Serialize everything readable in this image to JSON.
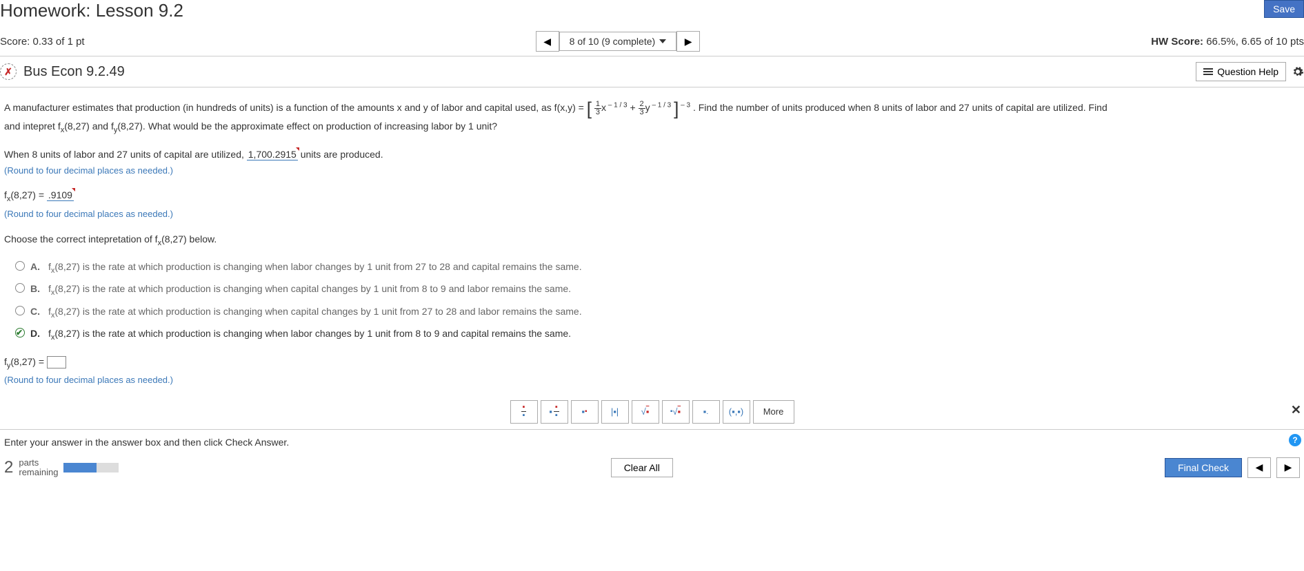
{
  "header": {
    "title": "Homework: Lesson 9.2",
    "save": "Save",
    "score_label": "Score:",
    "score_value": "0.33 of 1 pt",
    "nav_status": "8 of 10 (9 complete)",
    "hw_score_label": "HW Score:",
    "hw_score_value": "66.5%, 6.65 of 10 pts"
  },
  "question": {
    "title": "Bus Econ 9.2.49",
    "help_label": "Question Help"
  },
  "problem": {
    "pre_formula": "A manufacturer estimates that production (in hundreds of units) is a function of the amounts x and y of labor and capital used, as f(x,y) = ",
    "formula_exp_outer": " – 3",
    "post_formula": ". Find the number of units produced when 8 units of labor and 27 units of capital are utilized. Find",
    "line2": "and intepret f",
    "line2b": "(8,27) and f",
    "line2c": "(8,27). What would be the approximate effect on production of increasing labor by 1 unit?"
  },
  "parts": {
    "p1_pre": "When 8 units of labor and 27 units of capital are utilized, ",
    "p1_val": "1,700.2915",
    "p1_post": " units are produced.",
    "hint": "(Round to four decimal places as needed.)",
    "p2_pre": "f",
    "p2_mid": "(8,27) = ",
    "p2_val": ".9109",
    "choose": "Choose the correct intepretation of f",
    "choose_post": "(8,27) below."
  },
  "choices": [
    {
      "letter": "A.",
      "text": "(8,27) is the rate at which production is changing when labor changes by 1 unit from 27 to 28 and capital remains the same."
    },
    {
      "letter": "B.",
      "text": "(8,27) is the rate at which production is changing when capital changes by 1 unit from 8 to 9 and labor remains the same."
    },
    {
      "letter": "C.",
      "text": "(8,27) is the rate at which production is changing when capital changes by 1 unit from 27 to 28 and labor remains the same."
    },
    {
      "letter": "D.",
      "text": "(8,27) is the rate at which production is changing when labor changes by 1 unit from 8 to 9 and capital remains the same."
    }
  ],
  "p4": {
    "pre": "f",
    "mid": "(8,27) = "
  },
  "toolbar": {
    "more": "More"
  },
  "footer": {
    "instruction": "Enter your answer in the answer box and then click Check Answer.",
    "parts_num": "2",
    "parts_label_a": "parts",
    "parts_label_b": "remaining",
    "clear": "Clear All",
    "final": "Final Check"
  }
}
